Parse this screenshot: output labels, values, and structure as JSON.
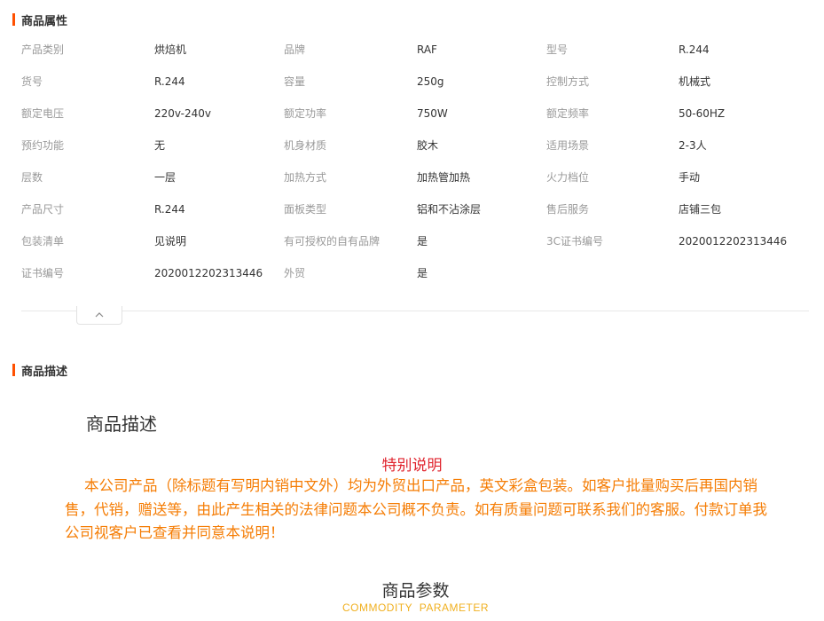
{
  "sections": {
    "attributes_title": "商品属性",
    "description_title": "商品描述"
  },
  "attributes": [
    [
      [
        "产品类别",
        "烘焙机"
      ],
      [
        "品牌",
        "RAF"
      ],
      [
        "型号",
        "R.244"
      ]
    ],
    [
      [
        "货号",
        "R.244"
      ],
      [
        "容量",
        "250g"
      ],
      [
        "控制方式",
        "机械式"
      ]
    ],
    [
      [
        "额定电压",
        "220v-240v"
      ],
      [
        "额定功率",
        "750W"
      ],
      [
        "额定频率",
        "50-60HZ"
      ]
    ],
    [
      [
        "预约功能",
        "无"
      ],
      [
        "机身材质",
        "胶木"
      ],
      [
        "适用场景",
        "2-3人"
      ]
    ],
    [
      [
        "层数",
        "一层"
      ],
      [
        "加热方式",
        "加热管加热"
      ],
      [
        "火力档位",
        "手动"
      ]
    ],
    [
      [
        "产品尺寸",
        "R.244"
      ],
      [
        "面板类型",
        "铝和不沾涂层"
      ],
      [
        "售后服务",
        "店铺三包"
      ]
    ],
    [
      [
        "包装清单",
        "见说明"
      ],
      [
        "有可授权的自有品牌",
        "是"
      ],
      [
        "3C证书编号",
        "2020012202313446"
      ]
    ],
    [
      [
        "证书编号",
        "2020012202313446"
      ],
      [
        "外贸",
        "是"
      ]
    ]
  ],
  "collapse_icon": "chevron-up-icon",
  "description": {
    "heading": "商品描述",
    "special_title": "特别说明",
    "special_body": "本公司产品（除标题有写明内销中文外）均为外贸出口产品，英文彩盒包装。如客户批量购买后再国内销售，代销，赠送等，由此产生相关的法律问题本公司概不负责。如有质量问题可联系我们的客服。付款订单我公司视客户已查看并同意本说明！",
    "param_title": "商品参数",
    "param_subtitle": "COMMODITY  PARAMETER"
  },
  "colors": {
    "accent": "#ff5000",
    "special_title": "#e0242e",
    "special_body": "#f57d05",
    "param_subtitle": "#f0b020"
  }
}
